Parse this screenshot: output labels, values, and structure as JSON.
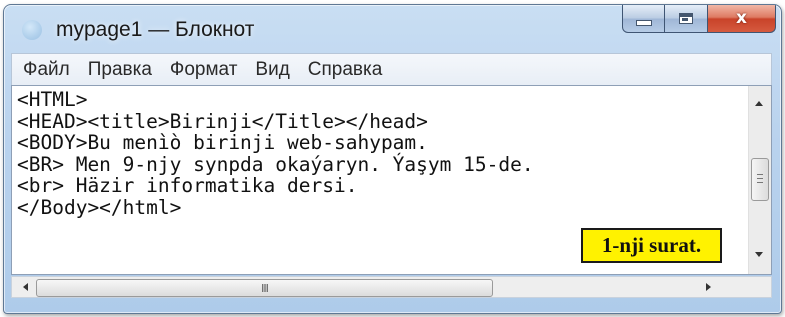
{
  "window": {
    "title": "mypage1 — Блокнот",
    "close_glyph": "x"
  },
  "menu": [
    "Файл",
    "Правка",
    "Формат",
    "Вид",
    "Справка"
  ],
  "editor": {
    "lines": [
      "<HTML>",
      "<HEAD><title>Birinji</Title></head>",
      "<BODY>Bu menìò birinji web-sahypam.",
      "<BR> Men 9-njy synpda okaýaryn. Ýaşym 15-de.",
      "<br> Häzir informatika dersi.",
      "</Body></html>"
    ]
  },
  "horizontal_scrollbar": {
    "grip": "III"
  },
  "caption": "1-nji surat.",
  "icons": {
    "app": "notepad-app-icon",
    "minimize": "minimize-icon",
    "maximize": "maximize-icon",
    "close": "close-icon",
    "scroll_up": "arrow-up-icon",
    "scroll_down": "arrow-down-icon",
    "scroll_left": "arrow-left-icon",
    "scroll_right": "arrow-right-icon"
  },
  "colors": {
    "caption_bg": "#fff200",
    "close_button": "#c9432a"
  }
}
